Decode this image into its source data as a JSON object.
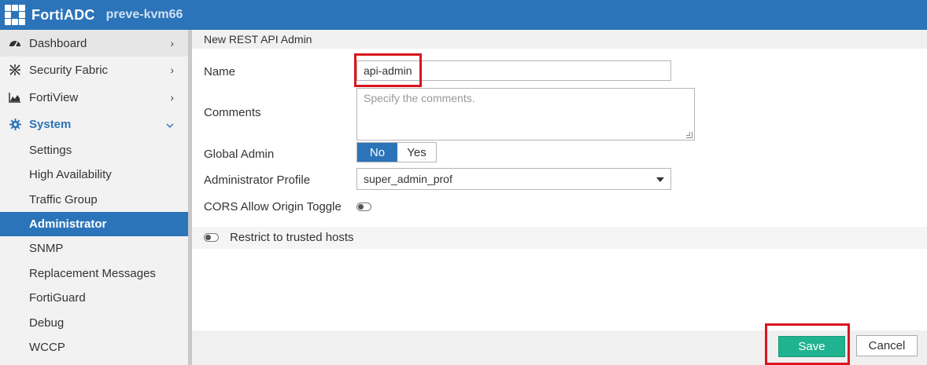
{
  "header": {
    "brand": "FortiADC",
    "hostname": "preve-kvm66"
  },
  "sidebar": {
    "items": [
      {
        "label": "Dashboard",
        "icon": "dashboard-gauge-icon"
      },
      {
        "label": "Security Fabric",
        "icon": "security-fabric-icon"
      },
      {
        "label": "FortiView",
        "icon": "area-chart-icon"
      },
      {
        "label": "System",
        "icon": "gear-icon",
        "expanded": true
      }
    ],
    "system_children": [
      {
        "label": "Settings"
      },
      {
        "label": "High Availability"
      },
      {
        "label": "Traffic Group"
      },
      {
        "label": "Administrator",
        "active": true
      },
      {
        "label": "SNMP"
      },
      {
        "label": "Replacement Messages"
      },
      {
        "label": "FortiGuard"
      },
      {
        "label": "Debug"
      },
      {
        "label": "WCCP"
      }
    ]
  },
  "form": {
    "title": "New REST API Admin",
    "name": {
      "label": "Name",
      "value": "api-admin"
    },
    "comments": {
      "label": "Comments",
      "placeholder": "Specify the comments."
    },
    "global_admin": {
      "label": "Global Admin",
      "options": [
        "No",
        "Yes"
      ],
      "selected": "No"
    },
    "admin_profile": {
      "label": "Administrator Profile",
      "value": "super_admin_prof"
    },
    "cors": {
      "label": "CORS Allow Origin Toggle",
      "enabled": false
    },
    "trusted_hosts": {
      "label": "Restrict to trusted hosts",
      "enabled": false
    }
  },
  "footer": {
    "save_label": "Save",
    "cancel_label": "Cancel"
  },
  "colors": {
    "brand_blue": "#2c74b9",
    "save_green": "#20b38f",
    "highlight_red": "#d9161e"
  }
}
